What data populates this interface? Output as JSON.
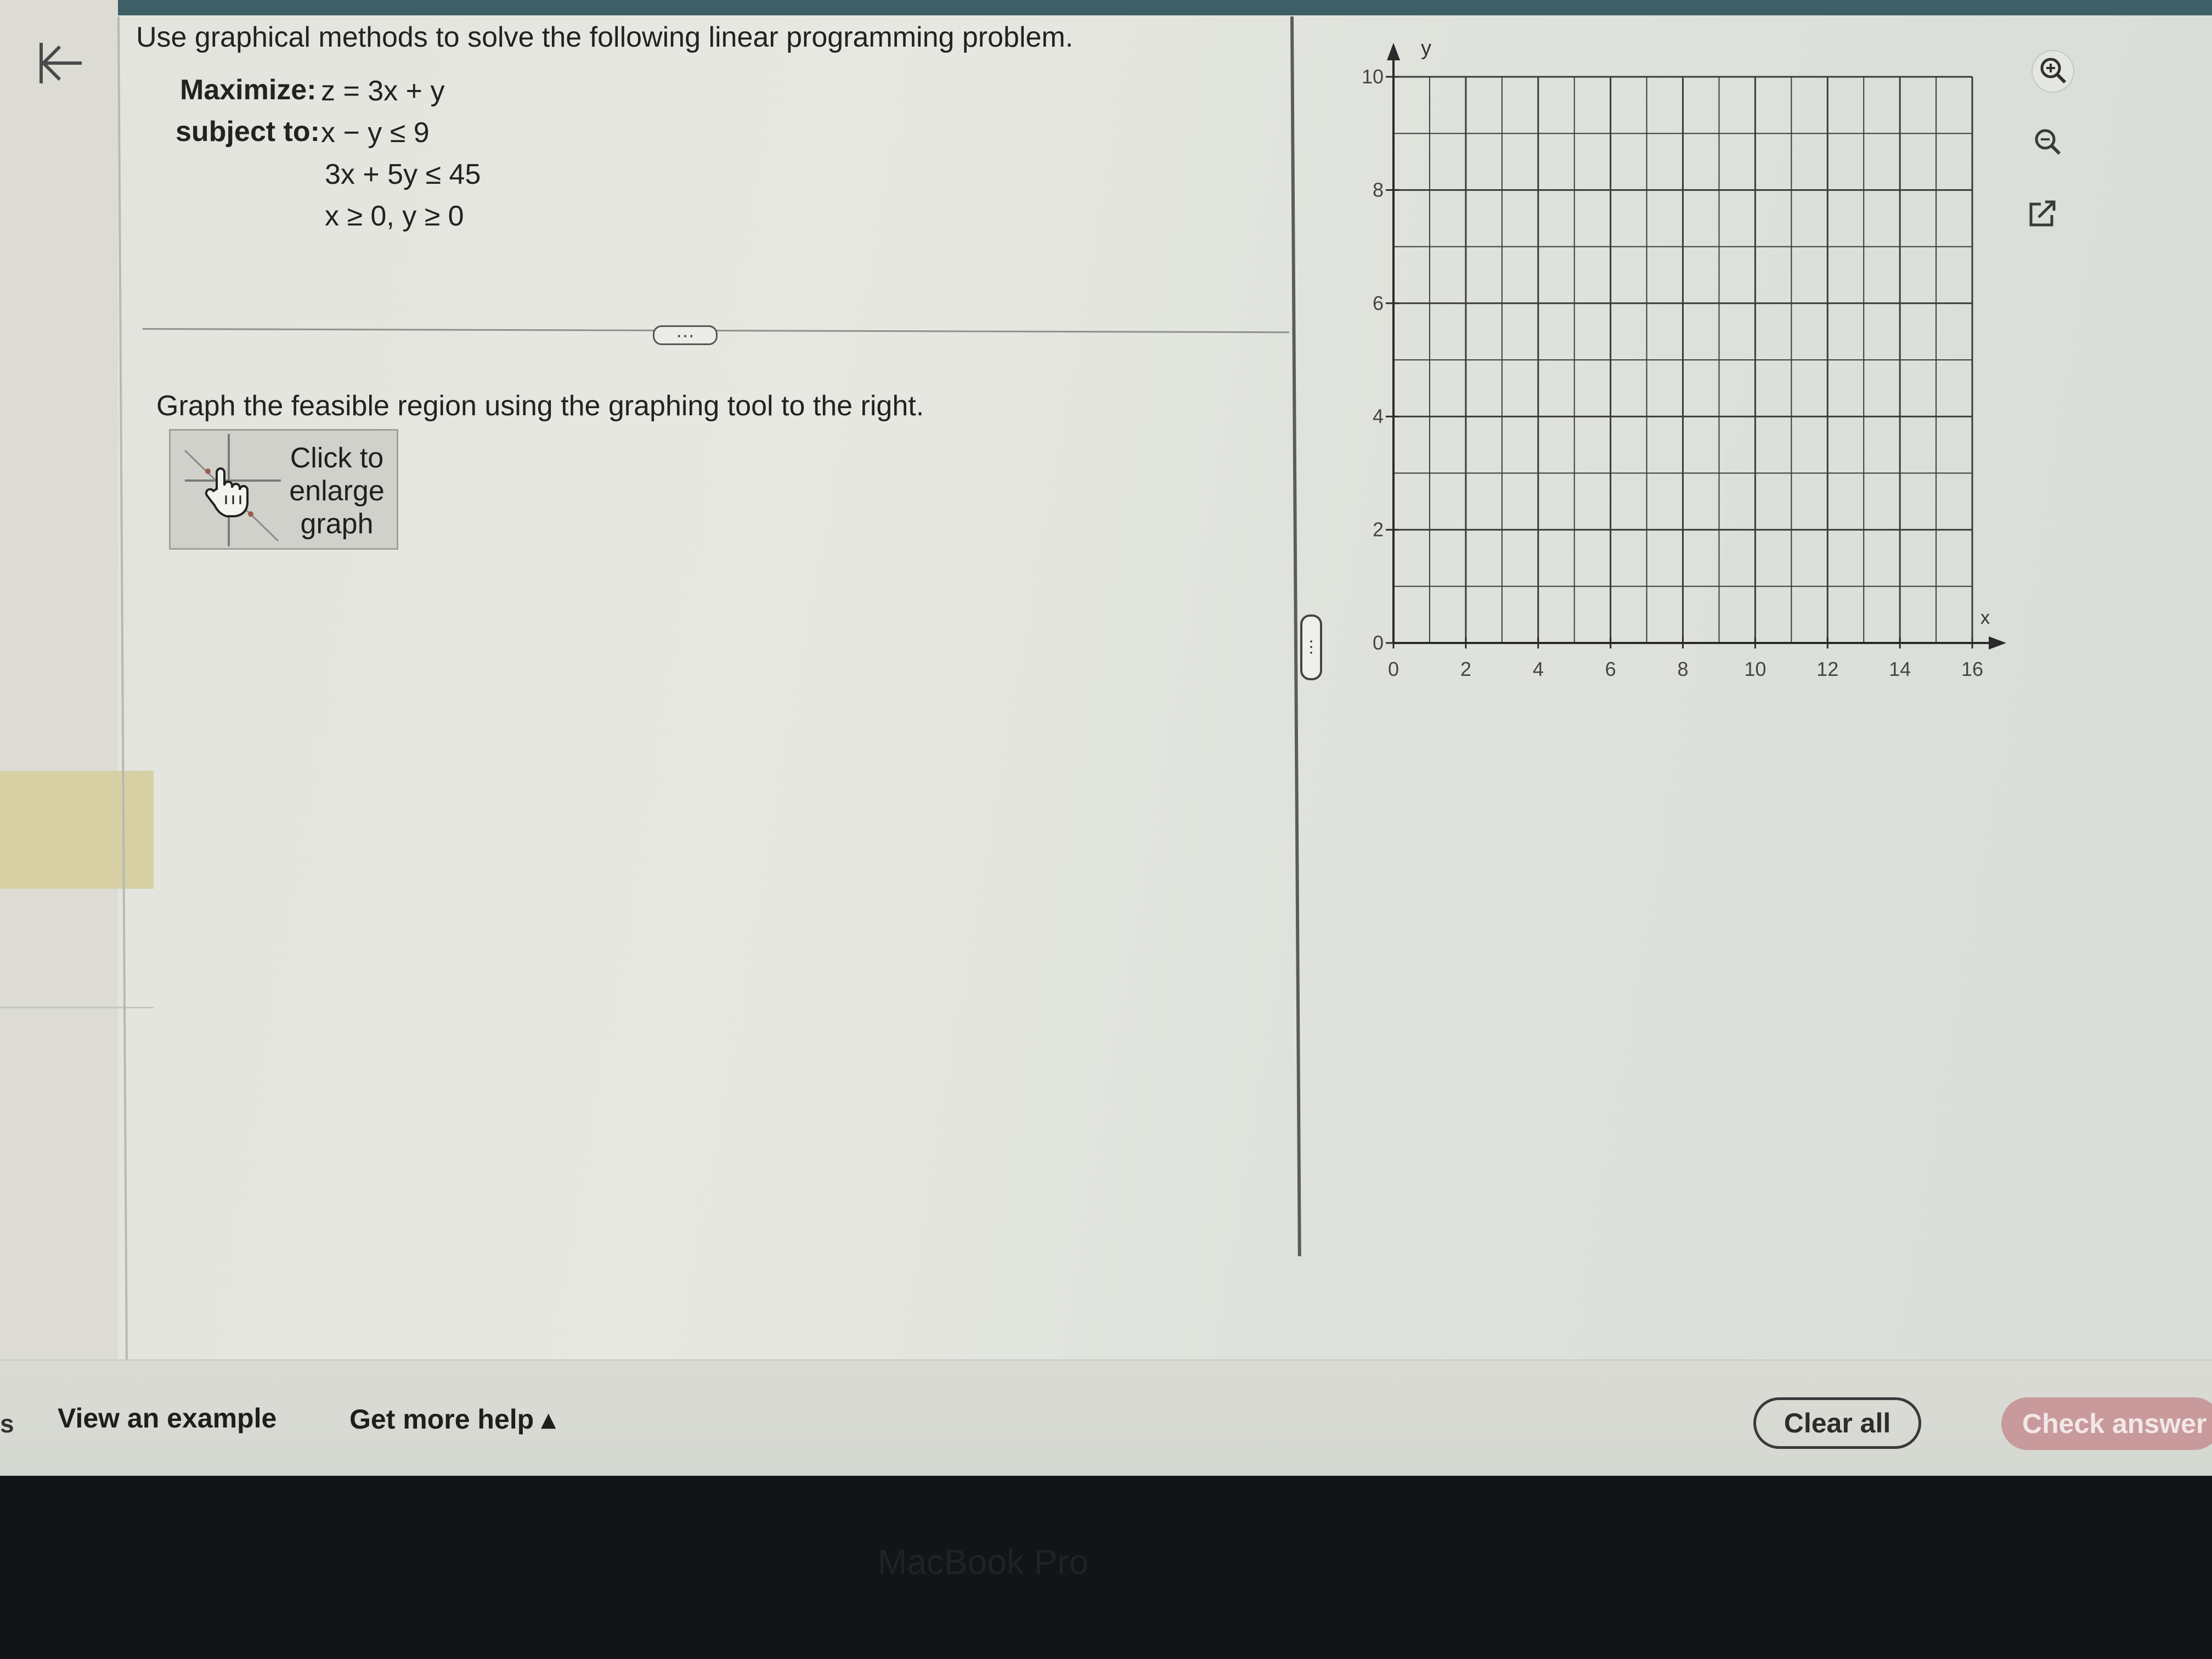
{
  "question": {
    "prompt": "Use graphical methods to solve the following linear programming problem.",
    "maximize_label": "Maximize:",
    "objective": "z = 3x + y",
    "subject_label": "subject to:",
    "constraints": [
      "x − y ≤ 9",
      "3x + 5y ≤ 45",
      "x ≥ 0, y ≥ 0"
    ],
    "instruction": "Graph the feasible region using the graphing tool to the right.",
    "enlarge_lines": [
      "Click to",
      "enlarge",
      "graph"
    ],
    "divider_more": "···"
  },
  "splitter_handle": "⋮",
  "icons": {
    "back": "back-arrow-icon",
    "zoom_in": "zoom-in-icon",
    "zoom_out": "zoom-out-icon",
    "popout": "popout-icon",
    "enlarge_thumb": "graph-thumbnail-icon",
    "hand": "hand-pointer-icon"
  },
  "chart_data": {
    "type": "grid",
    "xlabel": "x",
    "ylabel": "y",
    "xlim": [
      0,
      16
    ],
    "ylim": [
      0,
      10
    ],
    "x_ticks": [
      0,
      2,
      4,
      6,
      8,
      10,
      12,
      14,
      16
    ],
    "y_ticks": [
      0,
      2,
      4,
      6,
      8,
      10
    ],
    "x_tick_labels": [
      "0",
      "2",
      "4",
      "6",
      "8",
      "10",
      "12",
      "14",
      "16"
    ],
    "y_tick_labels": [
      "0",
      "2",
      "4",
      "6",
      "8",
      "10"
    ],
    "x_minor_step": 1,
    "y_minor_step": 1,
    "grid": true
  },
  "footer": {
    "edge_char": "s",
    "view_example": "View an example",
    "get_help": "Get more help ▴",
    "clear_all": "Clear all",
    "check_answer": "Check answer"
  },
  "laptop_brand": "MacBook Pro",
  "colors": {
    "check_answer_bg": "#c89a9c",
    "topbar": "#3e5f66",
    "grid_line": "#3a3c3a"
  }
}
